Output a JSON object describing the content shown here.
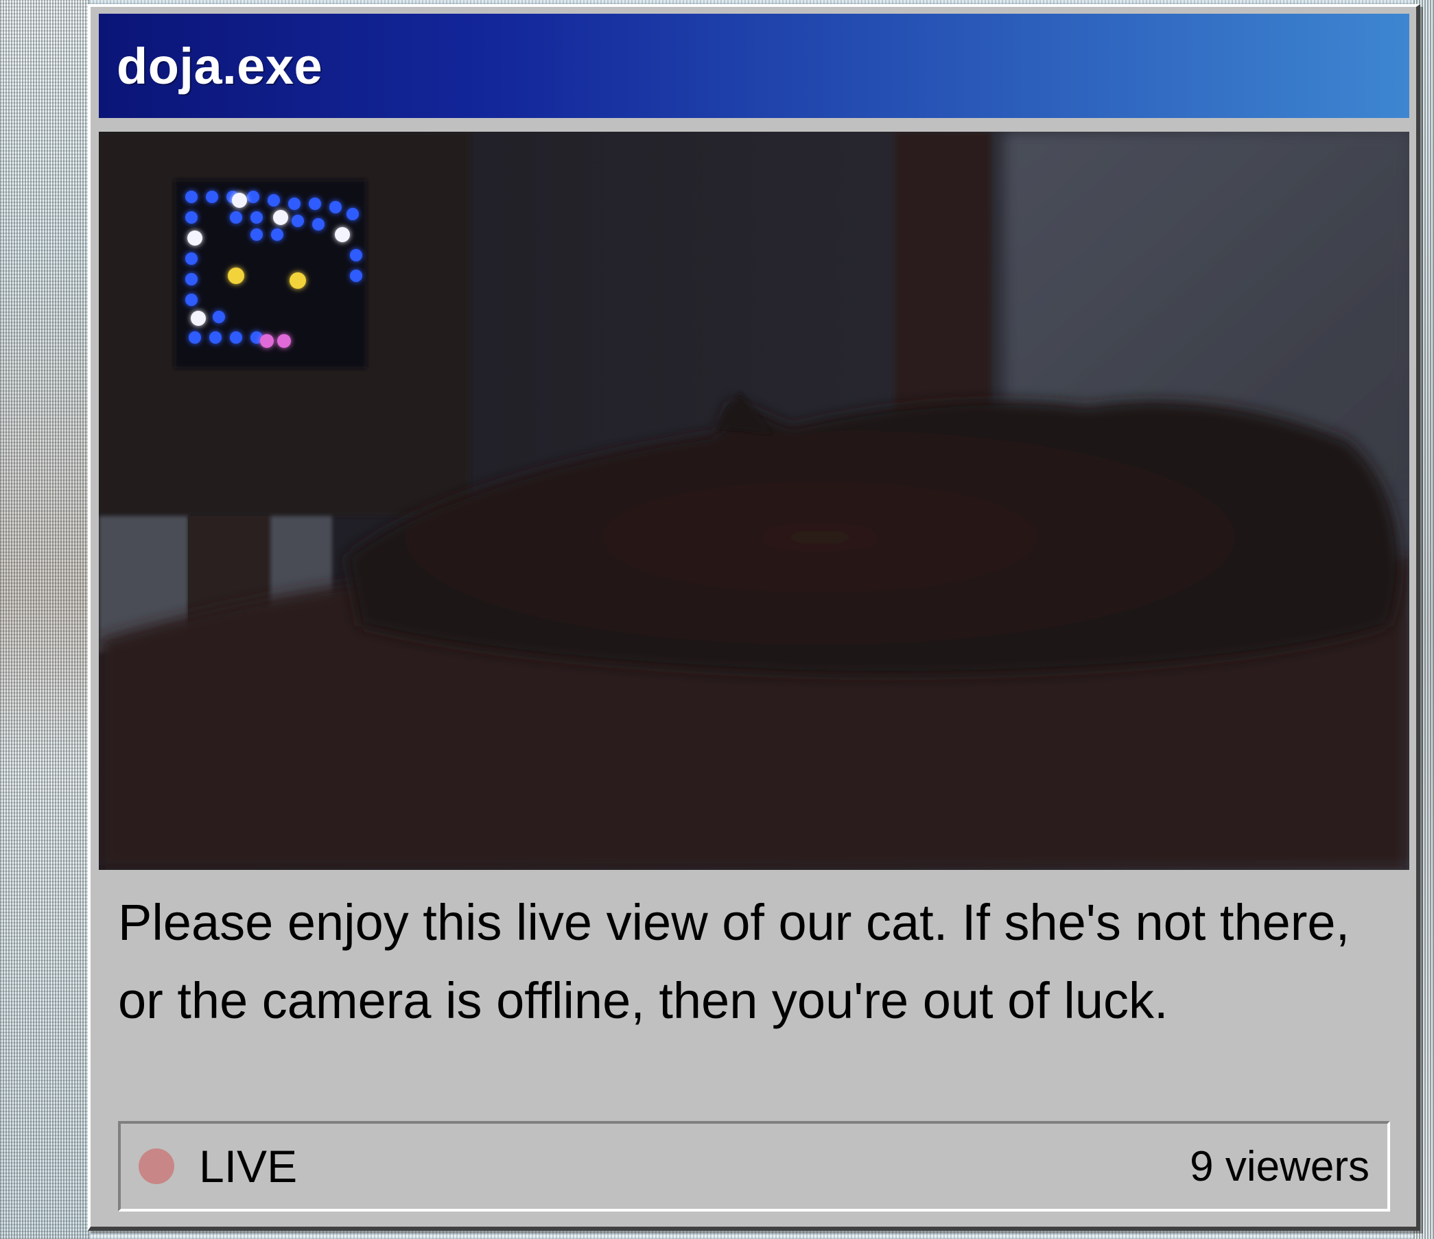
{
  "window": {
    "title": "doja.exe"
  },
  "camera": {
    "description": "Please enjoy this live view of our cat. If she's not there, or the camera is offline, then you're out of luck."
  },
  "status": {
    "live_label": "LIVE",
    "viewers_text": "9 viewers",
    "live_dot_color": "#c98686"
  },
  "colors": {
    "titlebar_start": "#0b1578",
    "titlebar_end": "#3e86d1",
    "window_face": "#c0c0c0"
  }
}
